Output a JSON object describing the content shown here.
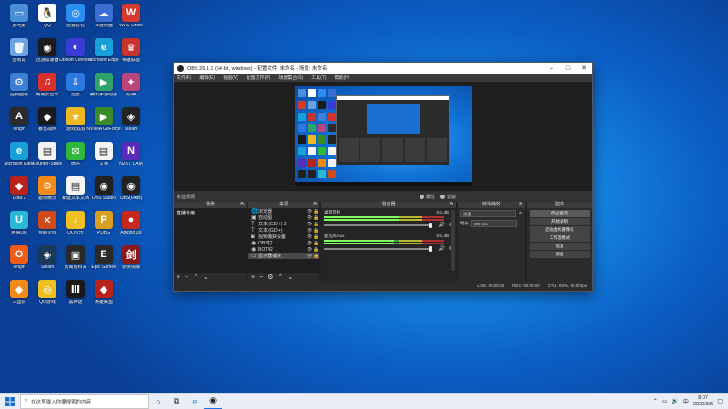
{
  "desktop": {
    "icons": [
      {
        "label": "此电脑",
        "color": "#4a90d9",
        "glyph": "▭"
      },
      {
        "label": "QQ",
        "color": "#ffffff",
        "glyph": "🐧"
      },
      {
        "label": "迅雷看看",
        "color": "#2a8df0",
        "glyph": "◎"
      },
      {
        "label": "百度网盘",
        "color": "#3b6fd6",
        "glyph": "☁"
      },
      {
        "label": "WPS Office",
        "color": "#d63a2f",
        "glyph": "W"
      },
      {
        "label": "回收站",
        "color": "#6aa4e0",
        "glyph": "🗑"
      },
      {
        "label": "迅游加速器",
        "color": "#1b1b1b",
        "glyph": "◉"
      },
      {
        "label": "Ubisoft Connect",
        "color": "#3b3bd6",
        "glyph": "◐"
      },
      {
        "label": "Microsoft Edge",
        "color": "#1aa0d8",
        "glyph": "e"
      },
      {
        "label": "英雄联盟",
        "color": "#c8342c",
        "glyph": "♛"
      },
      {
        "label": "控制面板",
        "color": "#3b7fd6",
        "glyph": "⚙"
      },
      {
        "label": "网易云音乐",
        "color": "#d8302c",
        "glyph": "♫"
      },
      {
        "label": "迅雷",
        "color": "#2b78e0",
        "glyph": "⇩"
      },
      {
        "label": "腾讯手游助手",
        "color": "#2fa36a",
        "glyph": "▶"
      },
      {
        "label": "原神",
        "color": "#b8467a",
        "glyph": "✦"
      },
      {
        "label": "Origin",
        "color": "#2b2b2b",
        "glyph": "A"
      },
      {
        "label": "暴雪战网",
        "color": "#1a1a1a",
        "glyph": "◆"
      },
      {
        "label": "游戏加加",
        "color": "#f0b820",
        "glyph": "★"
      },
      {
        "label": "NVIDIA GeForce",
        "color": "#3a8a2a",
        "glyph": "▶"
      },
      {
        "label": "Steam",
        "color": "#242424",
        "glyph": "◈"
      },
      {
        "label": "Microsoft Edge",
        "color": "#1aa0d8",
        "glyph": "e"
      },
      {
        "label": "Counter-Strike",
        "color": "#f4f4f4",
        "glyph": "▤"
      },
      {
        "label": "微信",
        "color": "#2fb83a",
        "glyph": "✉"
      },
      {
        "label": "文档",
        "color": "#f4f4f4",
        "glyph": "▤"
      },
      {
        "label": "NZXT CAM",
        "color": "#5a2ab8",
        "glyph": "N"
      },
      {
        "label": "Dota 2",
        "color": "#b8221a",
        "glyph": "◆"
      },
      {
        "label": "驱动精灵",
        "color": "#f28a1a",
        "glyph": "⚙"
      },
      {
        "label": "新建文本文档",
        "color": "#f4f4f4",
        "glyph": "▤"
      },
      {
        "label": "OBS Studio",
        "color": "#222222",
        "glyph": "◉"
      },
      {
        "label": "OBS(64bit)",
        "color": "#222222",
        "glyph": "◉"
      },
      {
        "label": "网易UU",
        "color": "#2ab8d8",
        "glyph": "U"
      },
      {
        "label": "穿越火线",
        "color": "#d04a1a",
        "glyph": "✕"
      },
      {
        "label": "QQ音乐",
        "color": "#f0c020",
        "glyph": "♪"
      },
      {
        "label": "PUBG",
        "color": "#d8a020",
        "glyph": "P"
      },
      {
        "label": "Among Us",
        "color": "#c8281e",
        "glyph": "●"
      },
      {
        "label": "Origin",
        "color": "#f25a1a",
        "glyph": "O"
      },
      {
        "label": "Steam",
        "color": "#1b3a5a",
        "glyph": "◈"
      },
      {
        "label": "逃离塔科夫",
        "color": "#2a2a2a",
        "glyph": "▣"
      },
      {
        "label": "Epic Games",
        "color": "#2a2a2a",
        "glyph": "E"
      },
      {
        "label": "剑侠情缘",
        "color": "#8a1a1a",
        "glyph": "剑"
      },
      {
        "label": "三国杀",
        "color": "#f08a1a",
        "glyph": "◆"
      },
      {
        "label": "QQ游戏",
        "color": "#f0c020",
        "glyph": "◎"
      },
      {
        "label": "黑神话",
        "color": "#1a1a1a",
        "glyph": "Ⅲ"
      },
      {
        "label": "英雄联盟",
        "color": "#b8221a",
        "glyph": "◆"
      }
    ]
  },
  "obs": {
    "title": "OBS 26.1.1 (64-bit, windows) - 配置文件: 未命名 - 场景: 未命名",
    "menu": [
      "文件(F)",
      "编辑(E)",
      "视图(V)",
      "配置文件(P)",
      "场景集合(S)",
      "工具(T)",
      "帮助(H)"
    ],
    "no_source_selected": "未选择源",
    "props_label": "属性",
    "filters_label": "滤镜",
    "docks": {
      "scenes": {
        "title": "场景",
        "items": [
          "直播专用"
        ]
      },
      "sources": {
        "title": "来源",
        "items": [
          {
            "name": "浏览器",
            "icon": "🌐"
          },
          {
            "name": "自动图",
            "icon": "▣"
          },
          {
            "name": "文本 (GDI+) 2",
            "icon": "T"
          },
          {
            "name": "文本 (GDI+)",
            "icon": "T"
          },
          {
            "name": "视频捕获设备",
            "icon": "◙"
          },
          {
            "name": "OBS打",
            "icon": "◉"
          },
          {
            "name": "BOT42",
            "icon": "◉"
          },
          {
            "name": "显示器捕获",
            "icon": "▭"
          }
        ]
      },
      "mixer": {
        "title": "混音器",
        "channels": [
          {
            "name": "桌面音频",
            "db": "-0.1 dB",
            "level": 0.62
          },
          {
            "name": "麦克风/Aux",
            "db": "-0.1 dB",
            "level": 0.58
          }
        ]
      },
      "transitions": {
        "title": "转场特效",
        "type": "淡出",
        "duration_label": "时长",
        "duration": "300 ms"
      },
      "controls": {
        "title": "控件",
        "buttons": [
          "停止推流",
          "开始录制",
          "启动虚拟摄像机",
          "工作室模式",
          "设置",
          "退出"
        ]
      }
    },
    "status": {
      "live": "LIVE: 00:00:00",
      "rec": "REC: 00:00:00",
      "cpu": "CPU: 0.0%, 60.00 fps"
    }
  },
  "taskbar": {
    "search_placeholder": "在这里输入你要搜索的内容",
    "time": "8:07",
    "date": "2022/3/5",
    "input_method": "中"
  }
}
